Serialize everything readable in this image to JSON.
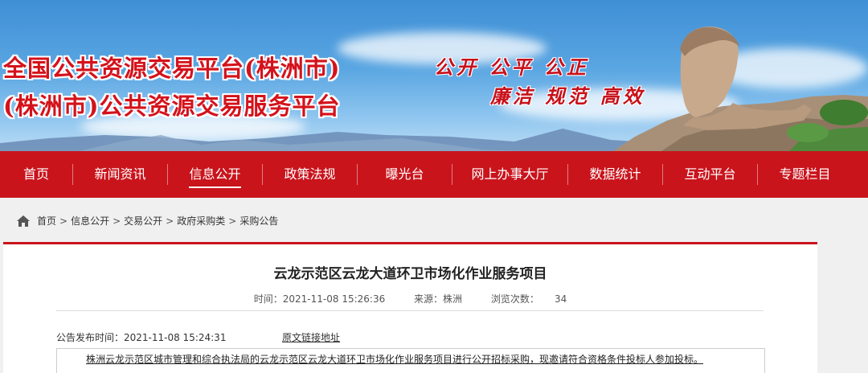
{
  "header": {
    "title_line1": "全国公共资源交易平台(株洲市)",
    "title_line2": "(株洲市)公共资源交易服务平台",
    "slogan_line1": "公开  公平  公正",
    "slogan_line2": "廉洁  规范  高效"
  },
  "nav": {
    "items": [
      {
        "label": "首页"
      },
      {
        "label": "新闻资讯"
      },
      {
        "label": "信息公开"
      },
      {
        "label": "政策法规"
      },
      {
        "label": "曝光台"
      },
      {
        "label": "网上办事大厅"
      },
      {
        "label": "数据统计"
      },
      {
        "label": "互动平台"
      },
      {
        "label": "专题栏目"
      }
    ],
    "active": "信息公开"
  },
  "breadcrumb": {
    "items": [
      "首页",
      "信息公开",
      "交易公开",
      "政府采购类",
      "采购公告"
    ],
    "separator": ">"
  },
  "article": {
    "title": "云龙示范区云龙大道环卫市场化作业服务项目",
    "meta_time": "时间：2021-11-08 15:26:36",
    "meta_source": "来源：株洲",
    "meta_views": "浏览次数：     34",
    "publish_time": "公告发布时间：2021-11-08 15:24:31",
    "origin_link": "原文链接地址",
    "notice_text": "株洲云龙示范区城市管理和综合执法局的云龙示范区云龙大道环卫市场化作业服务项目进行公开招标采购，现邀请符合资格条件投标人参加投标。"
  },
  "colors": {
    "brand_red": "#c9141c",
    "sky_blue": "#4a98dc"
  },
  "icons": {
    "home": "home-icon"
  }
}
